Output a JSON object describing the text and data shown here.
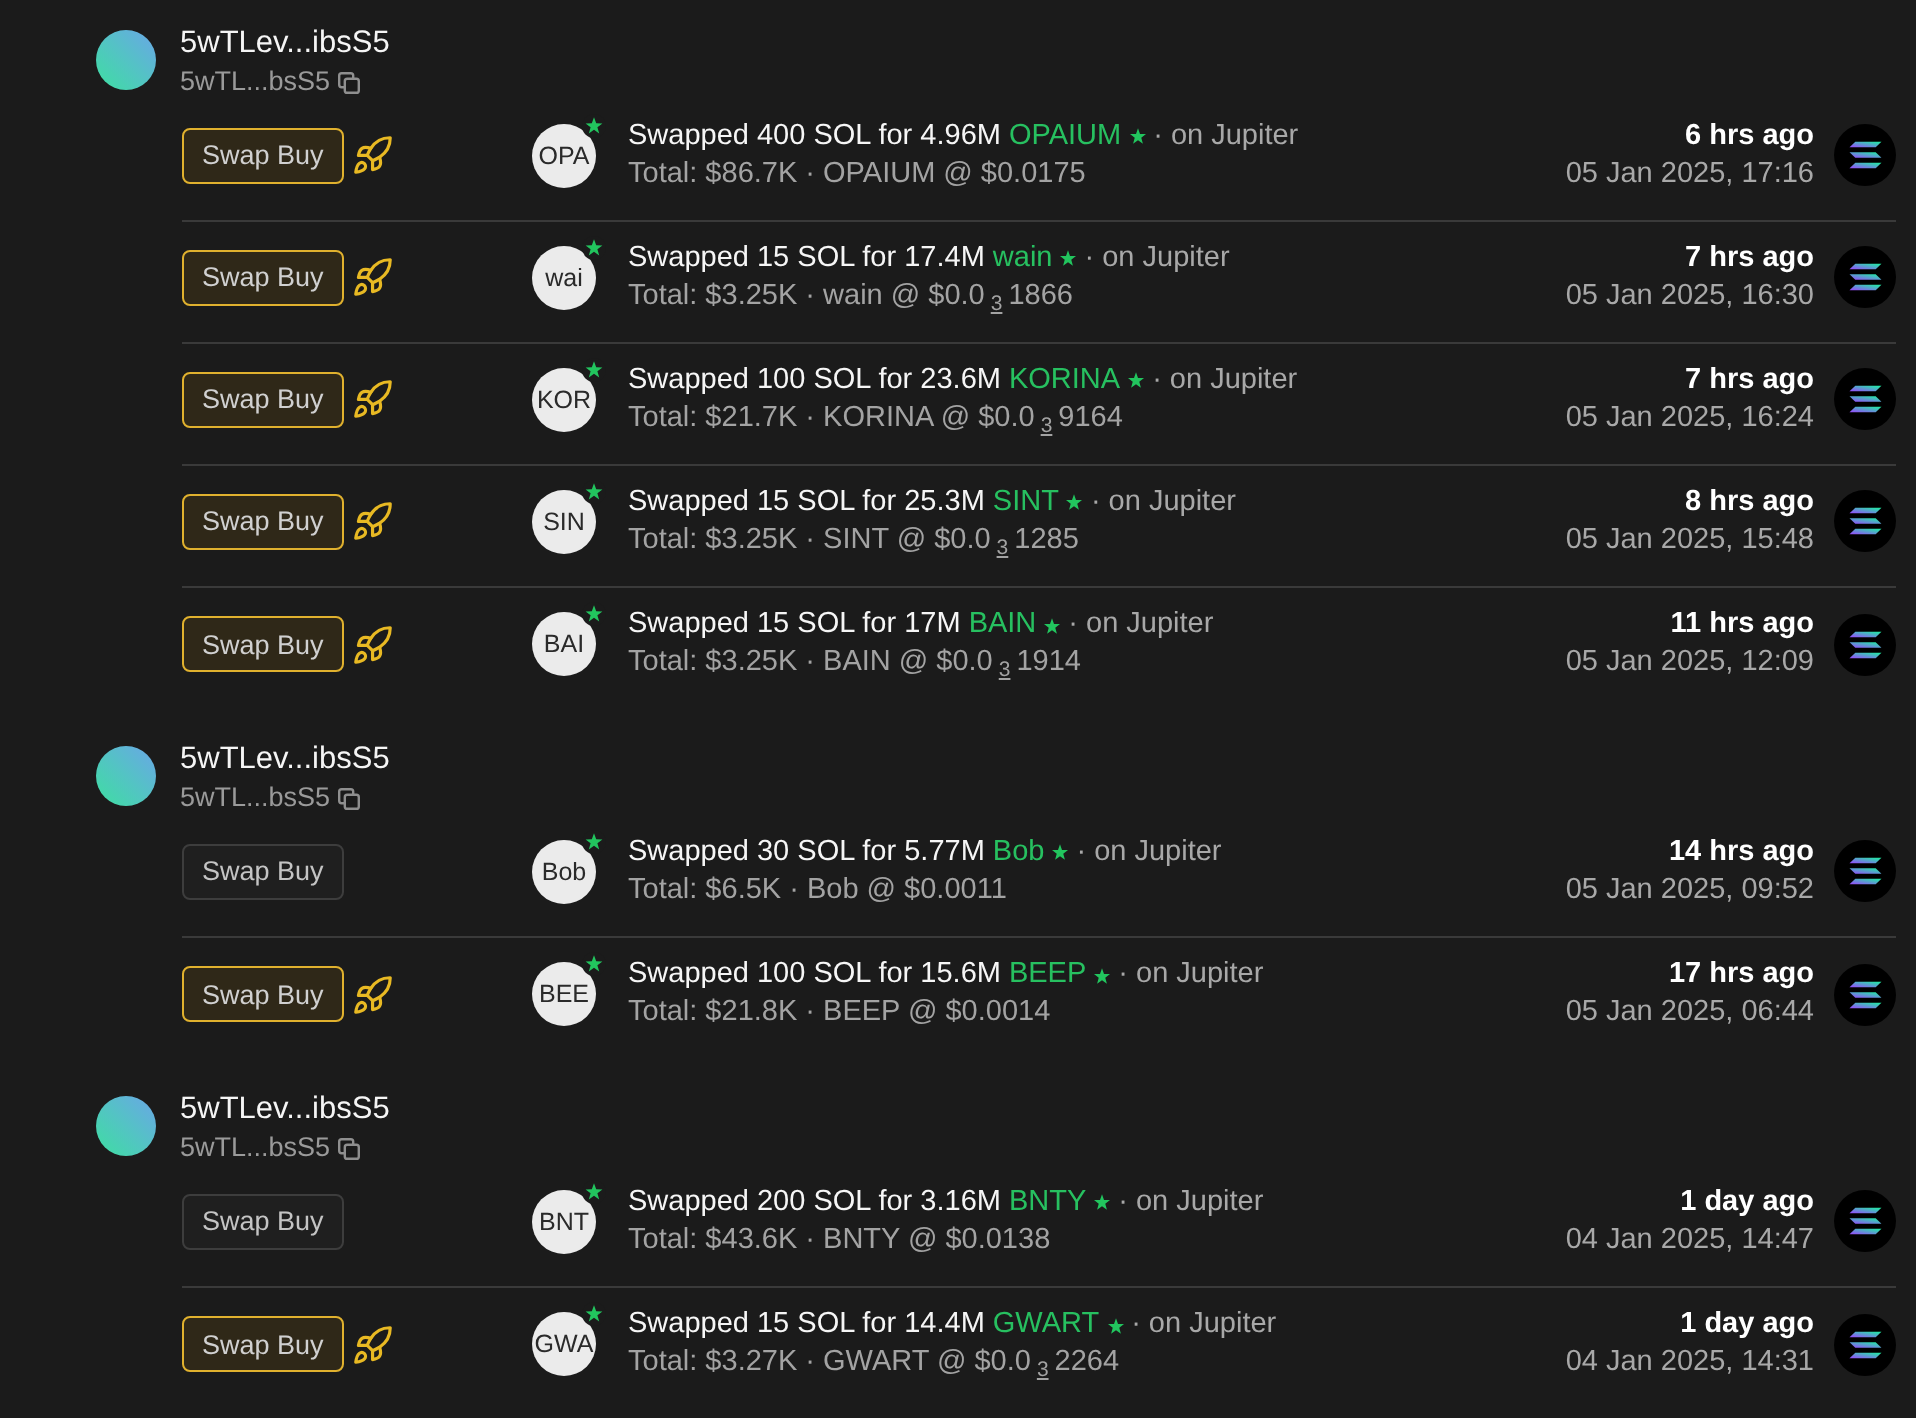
{
  "groups": [
    {
      "name": "5wTLev...ibsS5",
      "address": "5wTL...bsS5",
      "trades": [
        {
          "boosted": true,
          "action": "Swap Buy",
          "token_badge": "OPA",
          "summary": "Swapped 400 SOL for 4.96M",
          "token": "OPAIUM",
          "venue": "· on Jupiter",
          "total": "Total: $86.7K · OPAIUM @ $0.0175",
          "ago": "6 hrs ago",
          "date": "05 Jan 2025, 17:16"
        },
        {
          "boosted": true,
          "action": "Swap Buy",
          "token_badge": "wai",
          "summary": "Swapped 15 SOL for 17.4M",
          "token": "wain",
          "venue": "· on Jupiter",
          "total": "Total: $3.25K · wain @ $0.0$_{3}$1866",
          "ago": "7 hrs ago",
          "date": "05 Jan 2025, 16:30"
        },
        {
          "boosted": true,
          "action": "Swap Buy",
          "token_badge": "KOR",
          "summary": "Swapped 100 SOL for 23.6M",
          "token": "KORINA",
          "venue": "· on Jupiter",
          "total": "Total: $21.7K · KORINA @ $0.0$_{3}$9164",
          "ago": "7 hrs ago",
          "date": "05 Jan 2025, 16:24"
        },
        {
          "boosted": true,
          "action": "Swap Buy",
          "token_badge": "SIN",
          "summary": "Swapped 15 SOL for 25.3M",
          "token": "SINT",
          "venue": "· on Jupiter",
          "total": "Total: $3.25K · SINT @ $0.0$_{3}$1285",
          "ago": "8 hrs ago",
          "date": "05 Jan 2025, 15:48"
        },
        {
          "boosted": true,
          "action": "Swap Buy",
          "token_badge": "BAI",
          "summary": "Swapped 15 SOL for 17M",
          "token": "BAIN",
          "venue": "· on Jupiter",
          "total": "Total: $3.25K · BAIN @ $0.0$_{3}$1914",
          "ago": "11 hrs ago",
          "date": "05 Jan 2025, 12:09"
        }
      ]
    },
    {
      "name": "5wTLev...ibsS5",
      "address": "5wTL...bsS5",
      "trades": [
        {
          "boosted": false,
          "action": "Swap Buy",
          "token_badge": "Bob",
          "summary": "Swapped 30 SOL for 5.77M",
          "token": "Bob",
          "venue": "· on Jupiter",
          "total": "Total: $6.5K · Bob @ $0.0011",
          "ago": "14 hrs ago",
          "date": "05 Jan 2025, 09:52"
        },
        {
          "boosted": true,
          "action": "Swap Buy",
          "token_badge": "BEE",
          "summary": "Swapped 100 SOL for 15.6M",
          "token": "BEEP",
          "venue": "· on Jupiter",
          "total": "Total: $21.8K · BEEP @ $0.0014",
          "ago": "17 hrs ago",
          "date": "05 Jan 2025, 06:44"
        }
      ]
    },
    {
      "name": "5wTLev...ibsS5",
      "address": "5wTL...bsS5",
      "trades": [
        {
          "boosted": false,
          "action": "Swap Buy",
          "token_badge": "BNT",
          "summary": "Swapped 200 SOL for 3.16M",
          "token": "BNTY",
          "venue": "· on Jupiter",
          "total": "Total: $43.6K · BNTY @ $0.0138",
          "ago": "1 day ago",
          "date": "04 Jan 2025, 14:47"
        },
        {
          "boosted": true,
          "action": "Swap Buy",
          "token_badge": "GWA",
          "summary": "Swapped 15 SOL for 14.4M",
          "token": "GWART",
          "venue": "· on Jupiter",
          "total": "Total: $3.27K · GWART @ $0.0$_{3}$2264",
          "ago": "1 day ago",
          "date": "04 Jan 2025, 14:31"
        }
      ]
    }
  ]
}
